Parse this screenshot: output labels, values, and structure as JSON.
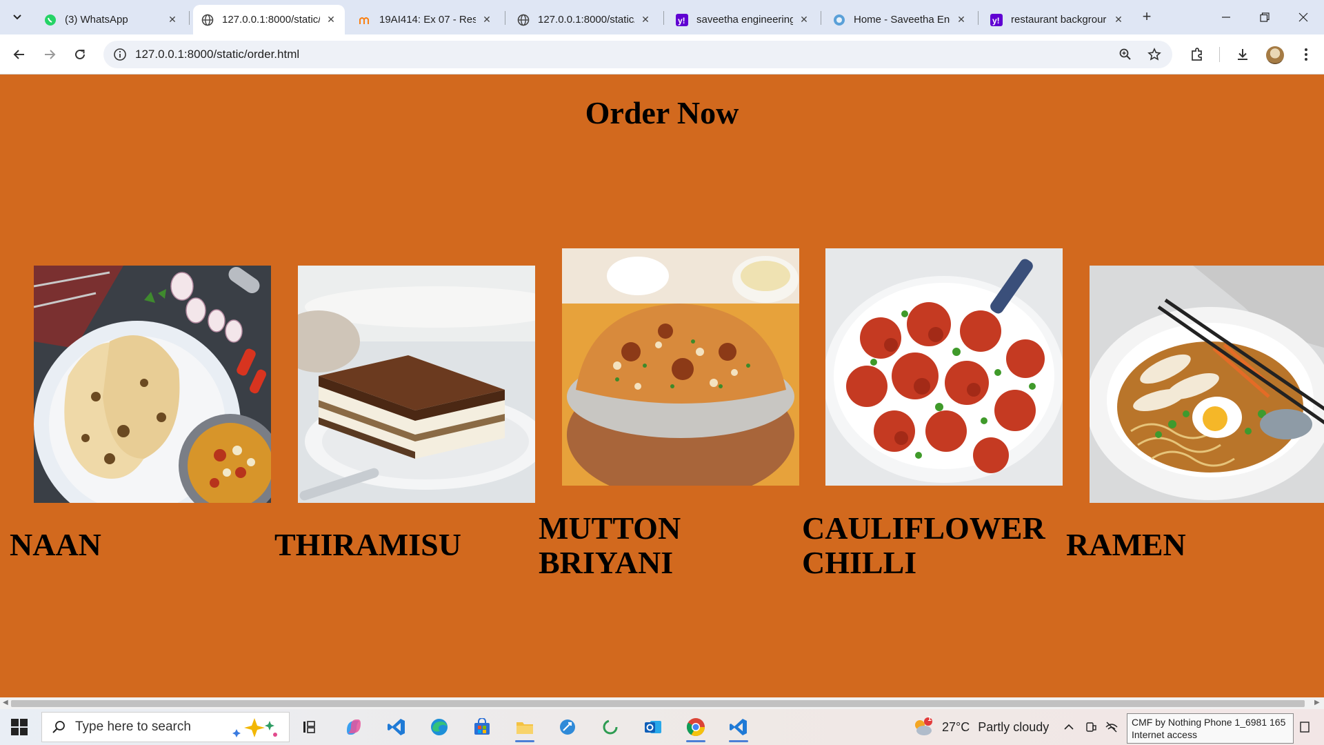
{
  "browser": {
    "tabs": [
      {
        "title": "(3) WhatsApp",
        "icon": "whatsapp-icon",
        "active": false
      },
      {
        "title": "127.0.0.1:8000/static/",
        "icon": "globe-icon",
        "active": true
      },
      {
        "title": "19AI414: Ex 07 - Rest",
        "icon": "moodle-icon",
        "active": false
      },
      {
        "title": "127.0.0.1:8000/static/",
        "icon": "globe-icon",
        "active": false
      },
      {
        "title": "saveetha engineering",
        "icon": "yahoo-icon",
        "active": false
      },
      {
        "title": "Home - Saveetha Eng",
        "icon": "saveetha-icon",
        "active": false
      },
      {
        "title": "restaurant backgrour",
        "icon": "yahoo-icon",
        "active": false
      }
    ],
    "address": "127.0.0.1:8000/static/order.html"
  },
  "page": {
    "title": "Order Now",
    "items": [
      {
        "name": "NAAN",
        "image": "naan-photo"
      },
      {
        "name": "THIRAMISU",
        "image": "tiramisu-photo"
      },
      {
        "name": "MUTTON BRIYANI",
        "image": "biryani-photo"
      },
      {
        "name": "CAULIFLOWER CHILLI",
        "image": "cauliflower-chilli-photo"
      },
      {
        "name": "RAMEN",
        "image": "ramen-photo"
      }
    ]
  },
  "taskbar": {
    "search_placeholder": "Type here to search",
    "weather": {
      "temp": "27°C",
      "condition": "Partly cloudy",
      "badge": "1"
    },
    "tooltip": {
      "line1": "CMF by Nothing Phone 1_6981 165",
      "line2": "Internet access"
    }
  },
  "colors": {
    "page_background": "#d2691e",
    "tabstrip": "#dfe6f4",
    "taskbar_accent": "#4a7fd6"
  }
}
